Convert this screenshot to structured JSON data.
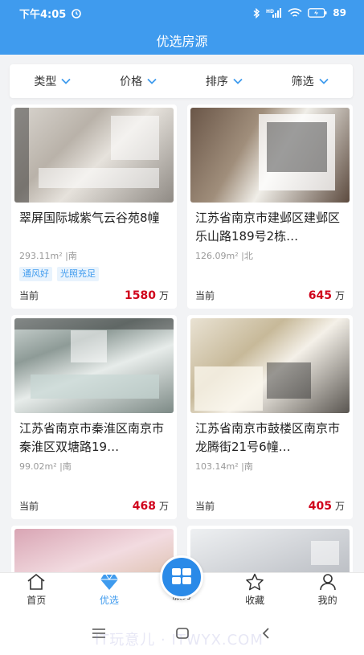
{
  "status": {
    "time": "下午4:05",
    "battery": "89"
  },
  "header": {
    "title": "优选房源"
  },
  "filters": [
    {
      "label": "类型"
    },
    {
      "label": "价格"
    },
    {
      "label": "排序"
    },
    {
      "label": "筛选"
    }
  ],
  "listings": [
    {
      "title": "翠屏国际城紫气云谷苑8幢",
      "meta": "293.11m² |南",
      "tags": [
        "通风好",
        "光照充足"
      ],
      "price_label": "当前",
      "price": "1580",
      "unit": "万"
    },
    {
      "title": "江苏省南京市建邺区建邺区乐山路189号2栋…",
      "meta": "126.09m² |北",
      "tags": [],
      "price_label": "当前",
      "price": "645",
      "unit": "万"
    },
    {
      "title": "江苏省南京市秦淮区南京市秦淮区双塘路19…",
      "meta": "99.02m² |南",
      "tags": [],
      "price_label": "当前",
      "price": "468",
      "unit": "万"
    },
    {
      "title": "江苏省南京市鼓楼区南京市龙腾街21号6幢…",
      "meta": "103.14m² |南",
      "tags": [],
      "price_label": "当前",
      "price": "405",
      "unit": "万"
    }
  ],
  "tabbar": {
    "home": "首页",
    "featured": "优选",
    "service": "服务",
    "favorites": "收藏",
    "mine": "我的"
  },
  "watermark": "IT玩意儿 · ITWYX.COM",
  "colors": {
    "accent": "#3f9bee",
    "price": "#d0021b"
  }
}
